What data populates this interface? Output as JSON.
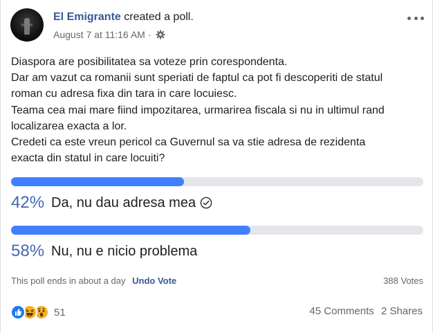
{
  "post": {
    "author": "El Emigrante",
    "action": "created a poll.",
    "date": "August 7 at 11:16 AM",
    "separator": "·",
    "body_lines": [
      "Diaspora are posibilitatea sa voteze prin corespondenta.",
      "Dar am vazut ca romanii sunt speriati de faptul ca pot fi descoperiti de statul",
      "roman cu adresa fixa din tara in care locuiesc.",
      "Teama cea mai mare fiind impozitarea, urmarirea fiscala si nu in ultimul rand",
      "localizarea exacta a lor.",
      "Credeti ca este vreun pericol ca Guvernul sa va stie adresa de rezidenta",
      "exacta din statul in care locuiti?"
    ]
  },
  "poll": {
    "options": [
      {
        "percent_label": "42%",
        "percent": 42,
        "label": "Da, nu dau adresa mea",
        "voted": true
      },
      {
        "percent_label": "58%",
        "percent": 58,
        "label": "Nu, nu e nicio problema",
        "voted": false
      }
    ],
    "ends_text": "This poll ends in about a day",
    "undo_label": "Undo Vote",
    "votes_text": "388 Votes"
  },
  "engagement": {
    "reactions": [
      "like-icon",
      "haha-icon",
      "wow-icon"
    ],
    "reaction_count": "51",
    "comments": "45 Comments",
    "shares": "2 Shares"
  },
  "colors": {
    "author": "#385898",
    "bar_fill": "#4080ff",
    "bar_track": "#e4e6ea",
    "percent": "#4267b2"
  }
}
